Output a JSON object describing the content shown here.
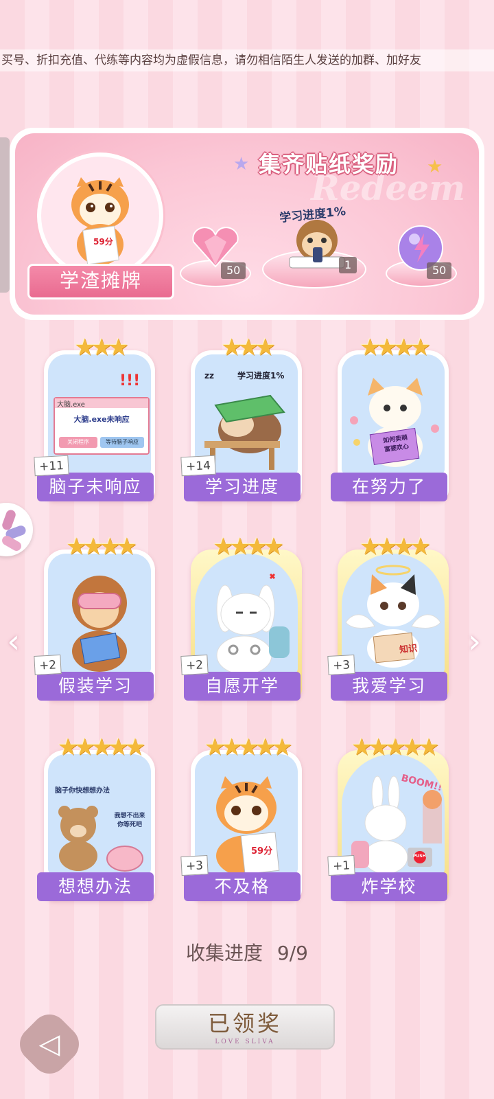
{
  "notice": "买号、折扣充值、代练等内容均为虚假信息，请勿相信陌生人发送的加群、加好友",
  "reward": {
    "title": "集齐贴纸奖励",
    "watermark": "Redeem",
    "avatar_banner": "学渣摊牌",
    "avatar_score": "59分",
    "progress_tag": "学习进度1%",
    "items": [
      {
        "icon": "pink-heart-gem-icon",
        "qty": "50"
      },
      {
        "icon": "monkey-sticker-icon",
        "qty": "1"
      },
      {
        "icon": "lightning-orb-icon",
        "qty": "50"
      }
    ]
  },
  "cards": [
    {
      "name": "脑子未响应",
      "count": "+11",
      "stars": "★★★",
      "art": "brain-not-responding-dialog",
      "dialog_title": "大脑.exe",
      "dialog_text": "大脑.exe未响应",
      "btn1": "关闭程序",
      "btn2": "等待脑子响应",
      "marks": "!!!"
    },
    {
      "name": "学习进度",
      "count": "+14",
      "stars": "★★★",
      "art": "sleeping-sloth",
      "caption": "学习进度1%",
      "zz": "zz"
    },
    {
      "name": "在努力了",
      "count": "",
      "stars": "★★★★",
      "art": "puppy-reading",
      "book": "如何卖萌 富婆欢心"
    },
    {
      "name": "假装学习",
      "count": "+2",
      "stars": "★★★★",
      "art": "monkey-with-mask"
    },
    {
      "name": "自愿开学",
      "count": "+2",
      "stars": "★★★★",
      "art": "bunny-handcuffed"
    },
    {
      "name": "我爱学习",
      "count": "+3",
      "stars": "★★★★",
      "art": "angel-cat",
      "book": "知识"
    },
    {
      "name": "想想办法",
      "count": "",
      "stars": "★★★★★",
      "art": "bear-and-brain",
      "bubble1": "脑子你快想想办法",
      "bubble2": "我想不出来 你等死吧"
    },
    {
      "name": "不及格",
      "count": "+3",
      "stars": "★★★★★",
      "art": "tiger-failed-test",
      "score": "59分"
    },
    {
      "name": "炸学校",
      "count": "+1",
      "stars": "★★★★★",
      "art": "bunny-boom",
      "boom": "BOOM!!",
      "push": "PUSH"
    }
  ],
  "progress": {
    "label": "收集进度",
    "value": "9/9"
  },
  "claim": {
    "label": "已领奖",
    "sub": "LOVE SLIVA"
  },
  "nav": {
    "prev": "‹",
    "next": "›"
  }
}
